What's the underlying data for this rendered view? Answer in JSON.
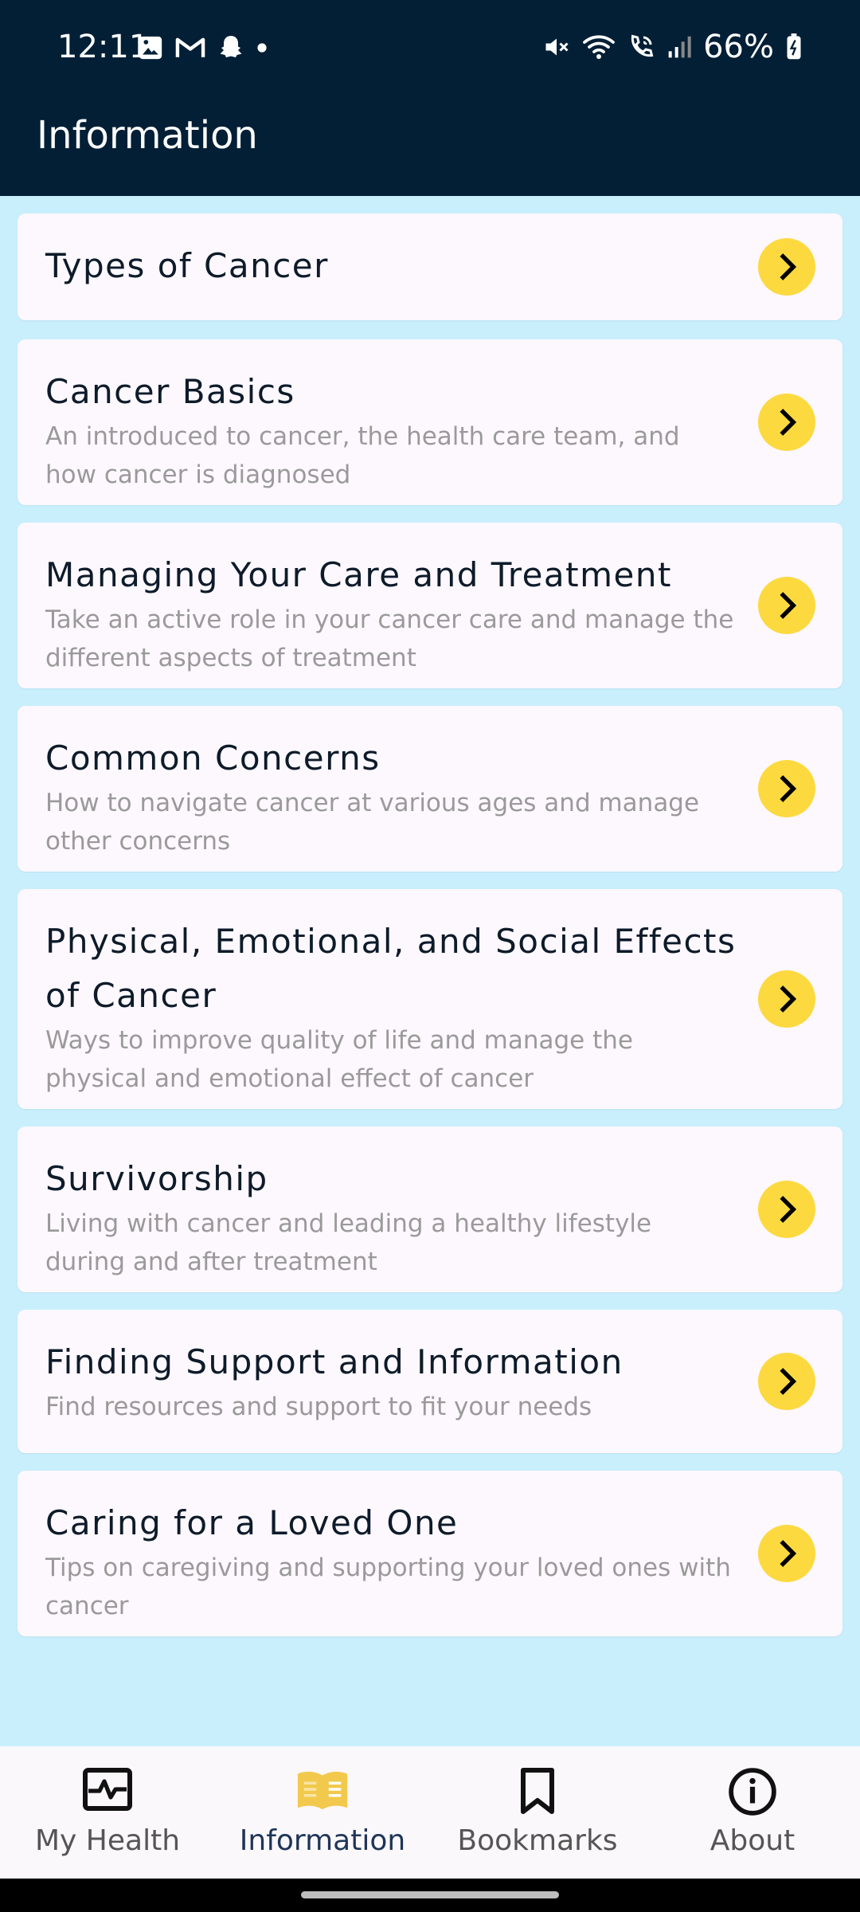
{
  "status_bar": {
    "time": "12:11",
    "battery": "66%",
    "left_icons": [
      "gallery-icon",
      "gmail-icon",
      "snapchat-icon",
      "dot-icon"
    ],
    "right_icons": [
      "mute-icon",
      "wifi-icon",
      "wifi-calling-icon",
      "signal-icon",
      "battery-icon"
    ]
  },
  "app_bar": {
    "title": "Information"
  },
  "items": [
    {
      "title": "Types of Cancer",
      "desc": ""
    },
    {
      "title": "Cancer Basics",
      "desc": "An introduced to cancer, the health care team, and how cancer is diagnosed"
    },
    {
      "title": "Managing Your Care and Treatment",
      "desc": "Take an active role in your cancer care and manage the different aspects of treatment"
    },
    {
      "title": "Common Concerns",
      "desc": "How to navigate cancer at various ages and manage other concerns"
    },
    {
      "title": "Physical, Emotional, and Social Effects of Cancer",
      "desc": "Ways to improve quality of life and manage the physical and emotional effect of cancer"
    },
    {
      "title": "Survivorship",
      "desc": "Living with cancer and leading a healthy lifestyle during and after treatment"
    },
    {
      "title": "Finding Support and Information",
      "desc": "Find resources and support to fit your needs"
    },
    {
      "title": "Caring for a Loved One",
      "desc": "Tips on caregiving and supporting your loved ones with cancer"
    }
  ],
  "nav": [
    {
      "label": "My Health",
      "icon": "health-monitor-icon",
      "active": false
    },
    {
      "label": "Information",
      "icon": "book-icon",
      "active": true
    },
    {
      "label": "Bookmarks",
      "icon": "bookmark-icon",
      "active": false
    },
    {
      "label": "About",
      "icon": "info-icon",
      "active": false
    }
  ],
  "colors": {
    "app_bar": "#021f36",
    "background": "#c9effd",
    "card": "#fdf8fd",
    "chevron_button": "#fcd93f",
    "active_nav": "#1e3557",
    "active_icon": "#f2c94c"
  }
}
